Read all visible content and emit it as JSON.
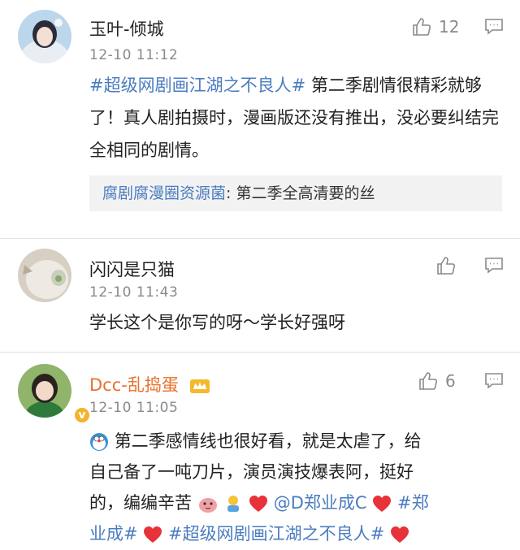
{
  "comments": [
    {
      "username": "玉叶-倾城",
      "time": "12-10 11:12",
      "likes": "12",
      "text_parts": [
        {
          "text": "#超级网剧画江湖之不良人#",
          "style": "blue"
        },
        {
          "text": " 第二季剧情很精彩就够了！真人剧拍摄时，漫画版还没有推出，没必要纠结完全相同的剧情。",
          "style": "plain"
        }
      ],
      "quote": {
        "name": "腐剧腐漫圈资源菌",
        "text": ": 第二季全高清要的丝"
      }
    },
    {
      "username": "闪闪是只猫",
      "time": "12-10 11:43",
      "likes": "",
      "text": "学长这个是你写的呀～学长好强呀"
    },
    {
      "username": "Dcc-乱捣蛋",
      "time": "12-10 11:05",
      "likes": "6",
      "verified_badge": "v",
      "text_line1": "第二季感情线也很好看，就是太虐了，给",
      "text_line2": "自己备了一吨刀片，演员演技爆表阿，挺好",
      "text_line3_prefix": "的，编编辛苦",
      "mention": "@D郑业成C",
      "hashtag1_a": "#郑",
      "hashtag1_b": "业成#",
      "hashtag2": "#超级网剧画江湖之不良人#"
    }
  ],
  "icons": {
    "like": "thumbs-up-icon",
    "reply": "comment-icon",
    "heart": "heart-emoji",
    "crown": "vip-crown-icon"
  },
  "colors": {
    "link": "#4a7cc0",
    "vip_name": "#e8712c",
    "meta": "#8a8a8a",
    "heart": "#e8323a"
  }
}
